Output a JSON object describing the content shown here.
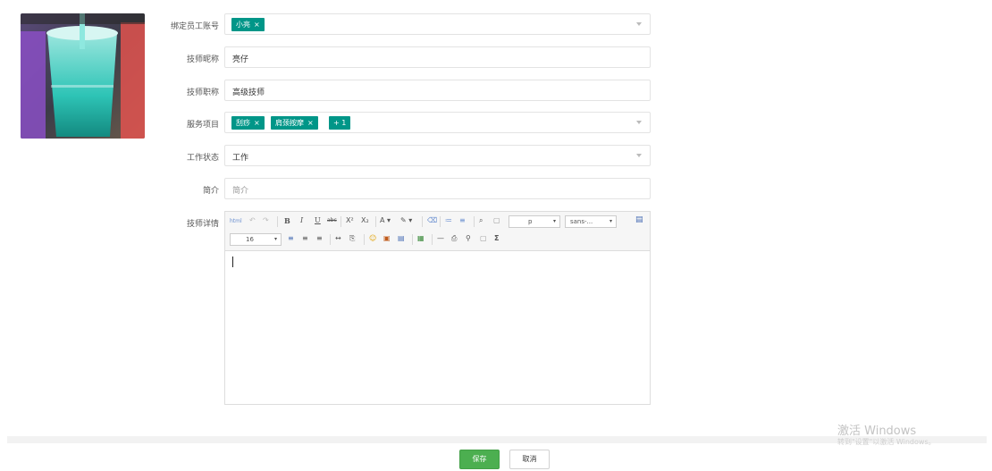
{
  "form": {
    "employee_label": "绑定员工账号",
    "employee_tags": [
      "小亮"
    ],
    "nickname_label": "技师昵称",
    "nickname_value": "亮仔",
    "title_label": "技师职称",
    "title_value": "高级技师",
    "services_label": "服务项目",
    "service_tags": [
      "刮痧",
      "肩颈按摩"
    ],
    "service_more": "+ 1",
    "status_label": "工作状态",
    "status_value": "工作",
    "intro_label": "简介",
    "intro_placeholder": "简介",
    "detail_label": "技师详情"
  },
  "editor": {
    "toolbar_row1": [
      "html",
      "↶",
      "↷",
      "B",
      "I",
      "U",
      "abc",
      "X²",
      "X₂",
      "A ▾",
      "✎ ▾",
      "⌫",
      "≔",
      "≡",
      "⌕",
      "▢"
    ],
    "paragraph_select": "p",
    "font_select": "sans-...",
    "fontsize_select": "16",
    "toolbar_row2": [
      "≡",
      "≡",
      "≡",
      "↔",
      "⎘",
      "☺",
      "▣",
      "▤",
      "▦",
      "—",
      "⎙",
      "⚲",
      "▢",
      "Σ"
    ]
  },
  "buttons": {
    "save": "保存",
    "cancel": "取消"
  },
  "watermark": {
    "line1": "激活 Windows",
    "line2": "转到\"设置\"以激活 Windows。"
  },
  "colors": {
    "tag_bg": "#009688",
    "save_bg": "#4caf50"
  }
}
